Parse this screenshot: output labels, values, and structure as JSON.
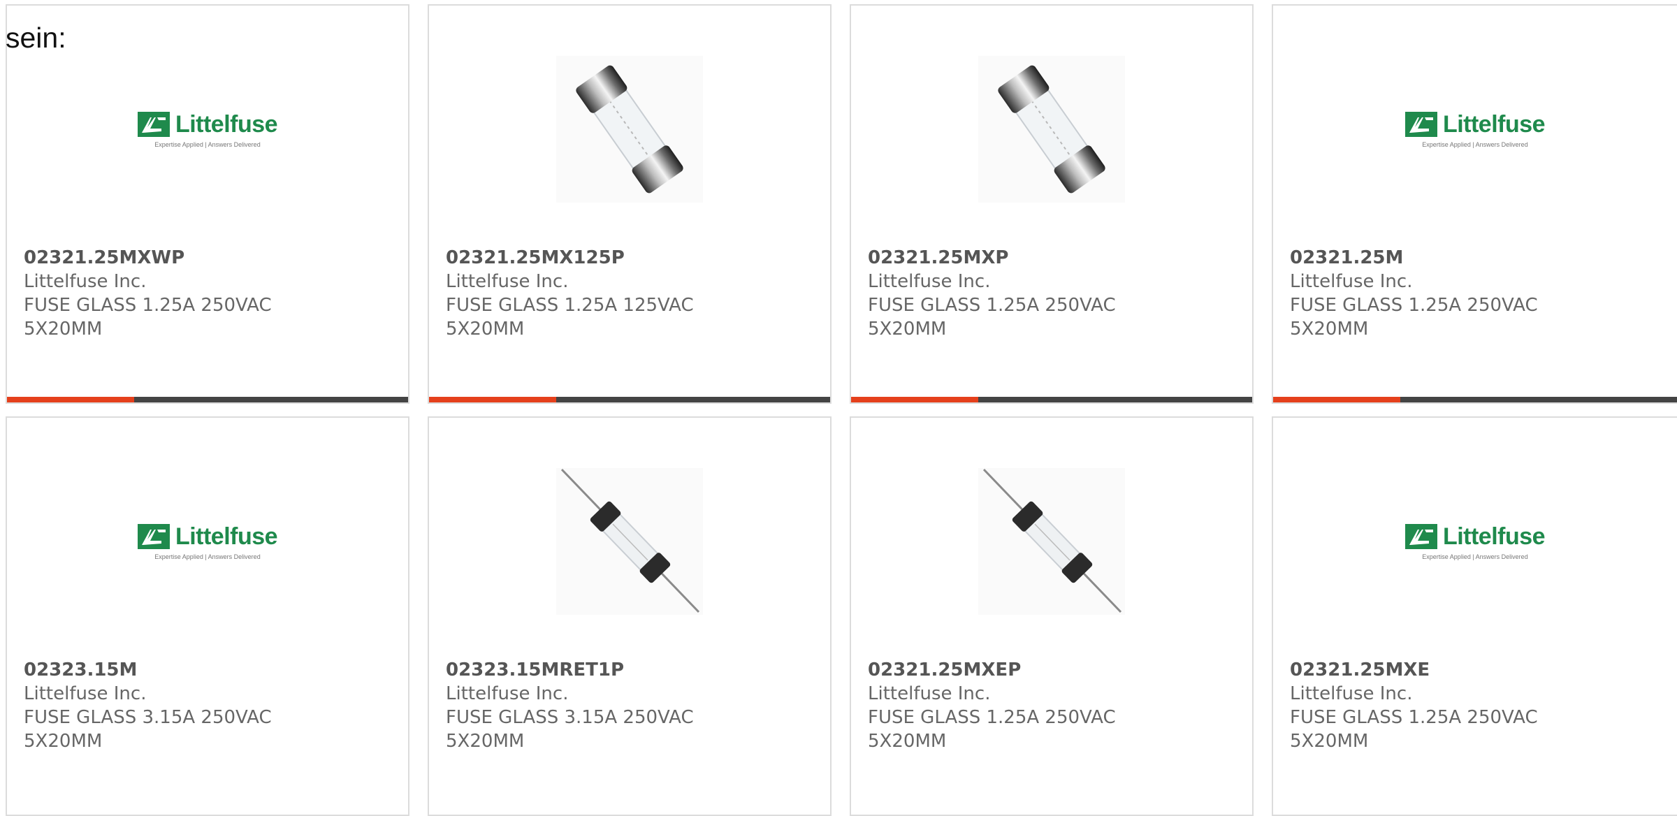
{
  "intro_text": "sein:",
  "colors": {
    "accent": "#e5401c",
    "bar": "#444444",
    "logo_green": "#1f8a4c",
    "card_border": "#dcdcdc"
  },
  "logo": {
    "word": "Littelfuse",
    "tagline": "Expertise Applied | Answers Delivered"
  },
  "products": [
    {
      "part_number": "02321.25MXWP",
      "manufacturer": "Littelfuse Inc.",
      "desc_line1": "FUSE GLASS 1.25A 250VAC",
      "desc_line2": "5X20MM",
      "image": "littelfuse-logo",
      "has_bar": true
    },
    {
      "part_number": "02321.25MX125P",
      "manufacturer": "Littelfuse Inc.",
      "desc_line1": "FUSE GLASS 1.25A 125VAC",
      "desc_line2": "5X20MM",
      "image": "glass-fuse-cartridge",
      "has_bar": true
    },
    {
      "part_number": "02321.25MXP",
      "manufacturer": "Littelfuse Inc.",
      "desc_line1": "FUSE GLASS 1.25A 250VAC",
      "desc_line2": "5X20MM",
      "image": "glass-fuse-cartridge",
      "has_bar": true
    },
    {
      "part_number": "02321.25M",
      "manufacturer": "Littelfuse Inc.",
      "desc_line1": "FUSE GLASS 1.25A 250VAC",
      "desc_line2": "5X20MM",
      "image": "littelfuse-logo",
      "has_bar": true
    },
    {
      "part_number": "02323.15M",
      "manufacturer": "Littelfuse Inc.",
      "desc_line1": "FUSE GLASS 3.15A 250VAC",
      "desc_line2": "5X20MM",
      "image": "littelfuse-logo",
      "has_bar": false
    },
    {
      "part_number": "02323.15MRET1P",
      "manufacturer": "Littelfuse Inc.",
      "desc_line1": "FUSE GLASS 3.15A 250VAC",
      "desc_line2": "5X20MM",
      "image": "glass-fuse-axial-leads",
      "has_bar": false
    },
    {
      "part_number": "02321.25MXEP",
      "manufacturer": "Littelfuse Inc.",
      "desc_line1": "FUSE GLASS 1.25A 250VAC",
      "desc_line2": "5X20MM",
      "image": "glass-fuse-axial-leads",
      "has_bar": false
    },
    {
      "part_number": "02321.25MXE",
      "manufacturer": "Littelfuse Inc.",
      "desc_line1": "FUSE GLASS 1.25A 250VAC",
      "desc_line2": "5X20MM",
      "image": "littelfuse-logo",
      "has_bar": false
    }
  ]
}
